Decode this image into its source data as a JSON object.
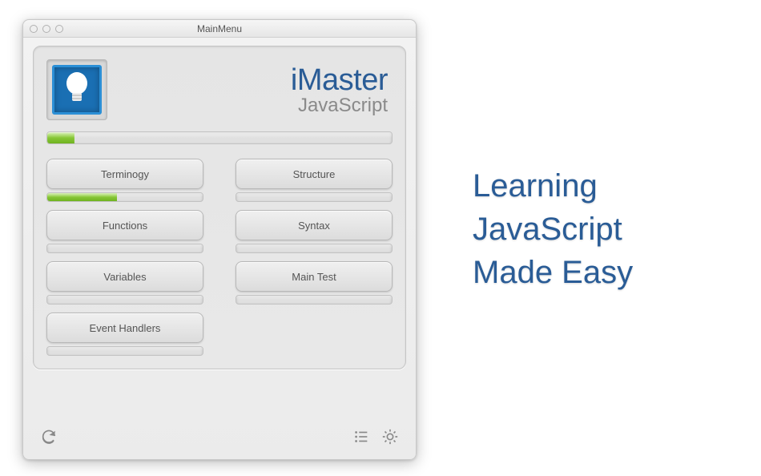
{
  "window": {
    "title": "MainMenu"
  },
  "header": {
    "title": "iMaster",
    "subtitle": "JavaScript"
  },
  "overall_progress_pct": 8,
  "sections": [
    {
      "label": "Terminogy",
      "progress_pct": 45
    },
    {
      "label": "Structure",
      "progress_pct": 0
    },
    {
      "label": "Functions",
      "progress_pct": 0
    },
    {
      "label": "Syntax",
      "progress_pct": 0
    },
    {
      "label": "Variables",
      "progress_pct": 0
    },
    {
      "label": "Main Test",
      "progress_pct": 0
    },
    {
      "label": "Event Handlers",
      "progress_pct": 0
    }
  ],
  "promo": {
    "line1": "Learning",
    "line2": "JavaScript",
    "line3": "Made Easy"
  }
}
